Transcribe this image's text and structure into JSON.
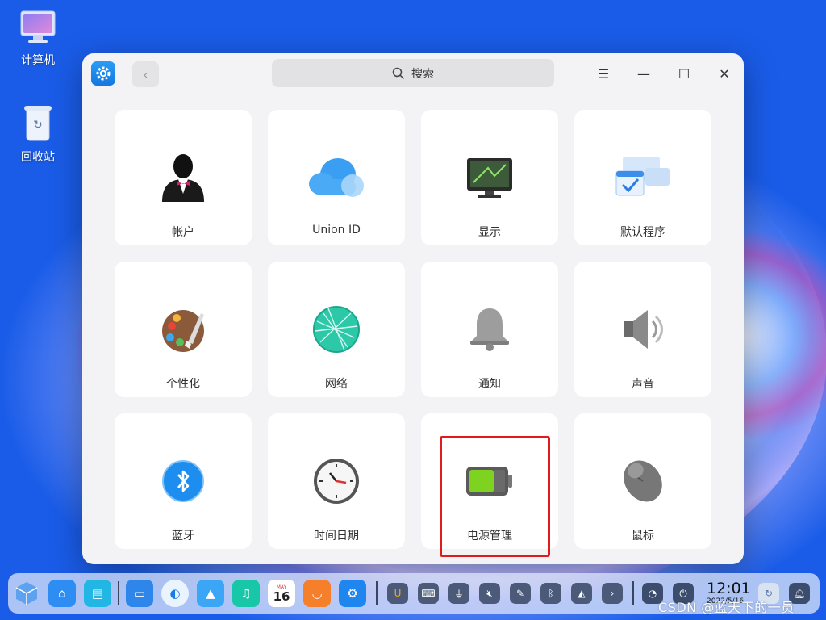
{
  "desktop": {
    "icons": [
      {
        "label": "计算机",
        "icon": "computer-icon"
      },
      {
        "label": "回收站",
        "icon": "trash-icon"
      }
    ]
  },
  "window": {
    "search_placeholder": "搜索",
    "back_icon": "chevron-left-icon",
    "controls": {
      "menu": "☰",
      "minimize": "—",
      "maximize": "☐",
      "close": "✕"
    },
    "tiles": [
      {
        "label": "帐户",
        "icon": "account-icon"
      },
      {
        "label": "Union ID",
        "icon": "cloud-icon"
      },
      {
        "label": "显示",
        "icon": "display-icon"
      },
      {
        "label": "默认程序",
        "icon": "default-apps-icon"
      },
      {
        "label": "个性化",
        "icon": "palette-icon"
      },
      {
        "label": "网络",
        "icon": "network-icon"
      },
      {
        "label": "通知",
        "icon": "bell-icon"
      },
      {
        "label": "声音",
        "icon": "speaker-icon"
      },
      {
        "label": "蓝牙",
        "icon": "bluetooth-icon"
      },
      {
        "label": "时间日期",
        "icon": "clock-icon"
      },
      {
        "label": "电源管理",
        "icon": "battery-icon"
      },
      {
        "label": "鼠标",
        "icon": "mouse-icon"
      }
    ],
    "highlighted_tile": "电源管理",
    "highlight_color": "#e01b1b"
  },
  "dock": {
    "calendar_month": "MAY",
    "calendar_day": "16",
    "clock_time": "12:01",
    "clock_date": "2022/5/16"
  },
  "watermark": "CSDN @蓝天下的一员"
}
